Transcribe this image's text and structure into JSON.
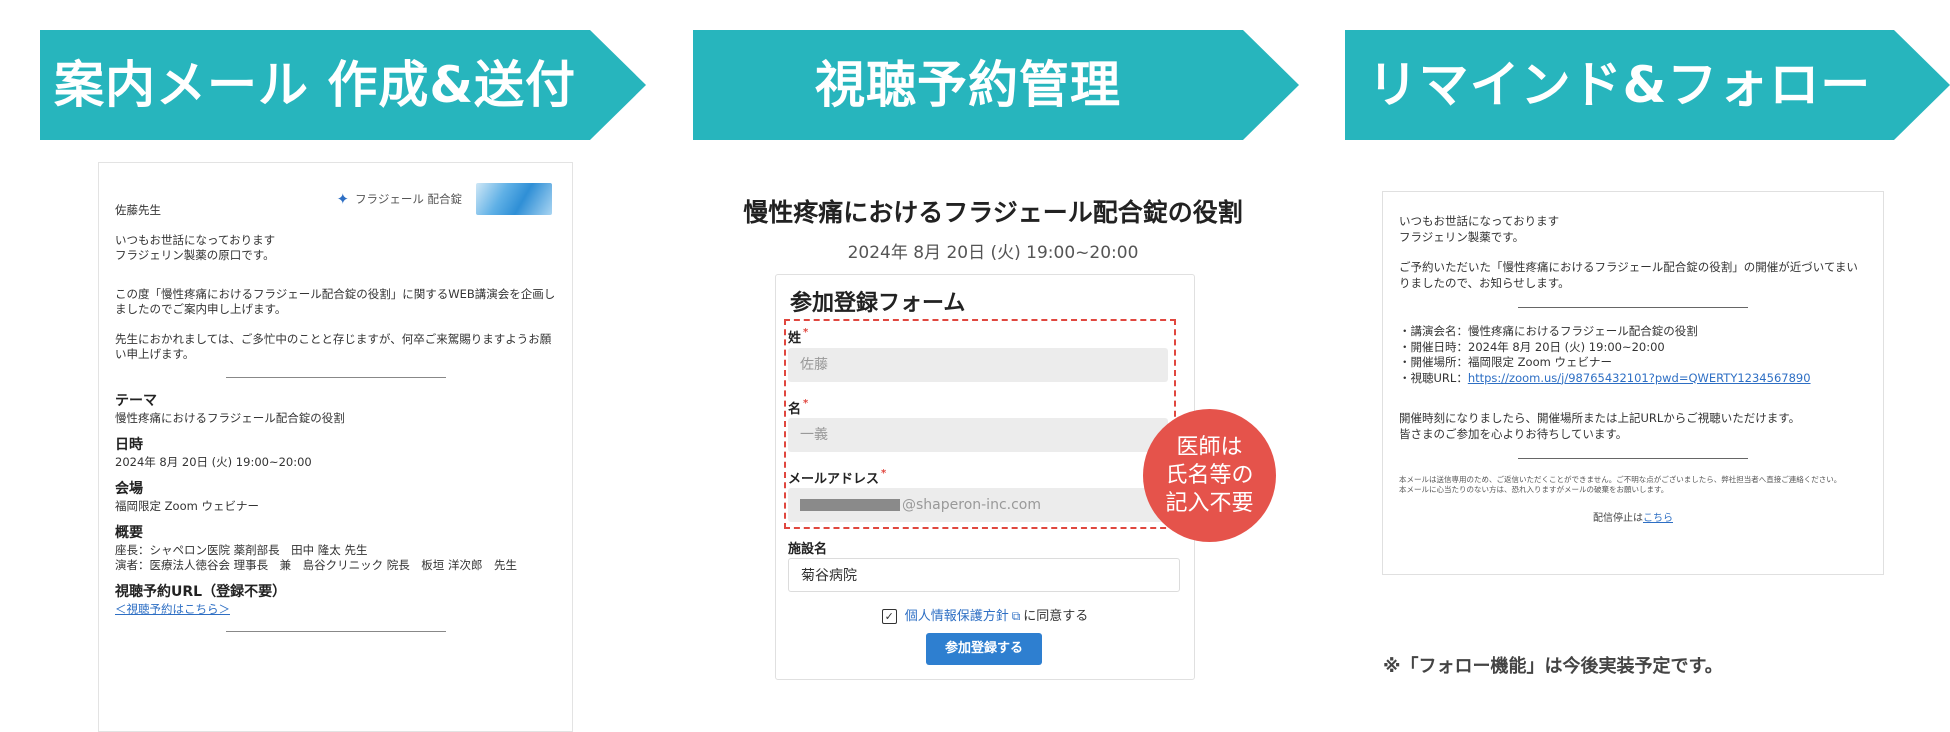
{
  "banners": {
    "step1": "案内メール 作成&送付",
    "step2": "視聴予約管理",
    "step3": "リマインド&フォロー"
  },
  "email": {
    "brand_name": "フラジェール 配合錠",
    "greeting": "佐藤先生",
    "intro_line1": "いつもお世話になっております",
    "intro_line2": "フラジェリン製薬の原口です。",
    "body1": "この度「慢性疼痛におけるフラジェール配合錠の役割」に関するWEB講演会を企画しましたのでご案内申し上げます。",
    "body2": "先生におかれましては、ご多忙中のことと存じますが、何卒ご来駕賜りますようお願い申上げます。",
    "theme_heading": "テーマ",
    "theme_value": "慢性疼痛におけるフラジェール配合錠の役割",
    "date_heading": "日時",
    "date_value": "2024年 8月 20日 (火) 19:00~20:00",
    "venue_heading": "会場",
    "venue_value": "福岡限定 Zoom ウェビナー",
    "summary_heading": "概要",
    "summary_line1": "座長：シャペロン医院 薬剤部長　田中 隆太 先生",
    "summary_line2": "演者：医療法人徳谷会 理事長　兼　島谷クリニック 院長　板垣 洋次郎　先生",
    "url_heading": "視聴予約URL（登録不要）",
    "url_link": "＜視聴予約はこちら＞"
  },
  "registration": {
    "seminar_title": "慢性疼痛におけるフラジェール配合錠の役割",
    "seminar_date": "2024年 8月 20日 (火) 19:00~20:00",
    "form_title": "参加登録フォーム",
    "last_name_label": "姓",
    "last_name_value": "佐藤",
    "first_name_label": "名",
    "first_name_value": "一義",
    "email_label": "メールアドレス",
    "email_domain": "@shaperon-inc.com",
    "facility_label": "施設名",
    "facility_value": "菊谷病院",
    "required_mark": "*",
    "policy_link": "個人情報保護方針",
    "consent_suffix": "に同意する",
    "submit_label": "参加登録する",
    "consent_checked": true
  },
  "badge": {
    "line1": "医師は",
    "line2": "氏名等の",
    "line3": "記入不要"
  },
  "reminder": {
    "line1": "いつもお世話になっております",
    "line2": "フラジェリン製薬です。",
    "body": "ご予約いただいた「慢性疼痛におけるフラジェール配合錠の役割」の開催が近づいてまいりましたので、お知らせします。",
    "item_title": "・講演会名：慢性疼痛におけるフラジェール配合錠の役割",
    "item_date": "・開催日時：2024年 8月 20日 (火) 19:00~20:00",
    "item_venue": "・開催場所：福岡限定 Zoom ウェビナー",
    "item_url_prefix": "・視聴URL：",
    "item_url": "https://zoom.us/j/98765432101?pwd=QWERTY1234567890",
    "closing1": "開催時刻になりましたら、開催場所または上記URLからご視聴いただけます。",
    "closing2": "皆さまのご参加を心よりお待ちしています。",
    "fine_print1": "本メールは送信専用のため、ご返信いただくことができません。ご不明な点がございましたら、弊社担当者へ直接ご連絡ください。",
    "fine_print2": "本メールに心当たりのない方は、恐れ入りますがメールの破棄をお願いします。",
    "unsubscribe_prefix": "配信停止は",
    "unsubscribe_link": "こちら"
  },
  "note": "※「フォロー機能」は今後実装予定です。",
  "colors": {
    "banner": "#27b5bd",
    "badge": "#e5534b",
    "link": "#2e6fc4",
    "submit": "#2e7fd0",
    "dash": "#e0473f"
  }
}
